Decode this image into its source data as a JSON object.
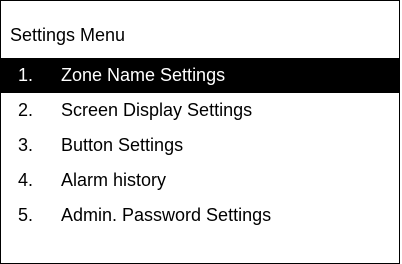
{
  "menu": {
    "title": "Settings Menu",
    "selected_index": 0,
    "items": [
      {
        "number": "1.",
        "label": "Zone Name Settings"
      },
      {
        "number": "2.",
        "label": "Screen Display Settings"
      },
      {
        "number": "3.",
        "label": "Button Settings"
      },
      {
        "number": "4.",
        "label": "Alarm history"
      },
      {
        "number": "5.",
        "label": "Admin. Password Settings"
      }
    ]
  },
  "colors": {
    "selected_background": "#000000",
    "selected_text": "#ffffff",
    "text": "#000000",
    "background": "#ffffff"
  }
}
